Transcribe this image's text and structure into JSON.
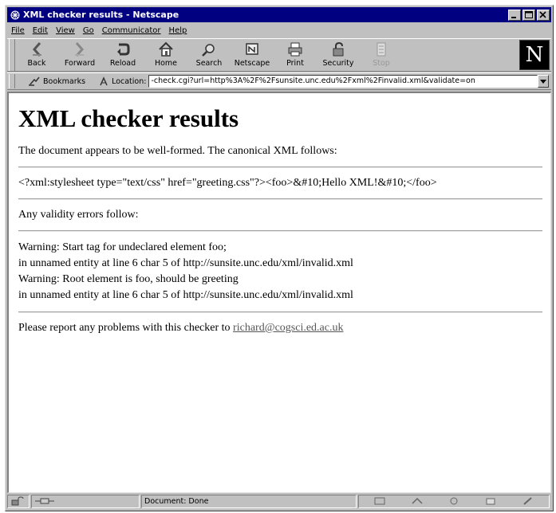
{
  "window": {
    "title": "XML checker results - Netscape"
  },
  "menu": [
    "File",
    "Edit",
    "View",
    "Go",
    "Communicator",
    "Help"
  ],
  "toolbar": [
    {
      "label": "Back",
      "icon": "back-arrow-icon",
      "enabled": true
    },
    {
      "label": "Forward",
      "icon": "forward-arrow-icon",
      "enabled": true
    },
    {
      "label": "Reload",
      "icon": "reload-icon",
      "enabled": true
    },
    {
      "label": "Home",
      "icon": "home-icon",
      "enabled": true
    },
    {
      "label": "Search",
      "icon": "search-icon",
      "enabled": true
    },
    {
      "label": "Netscape",
      "icon": "netscape-icon",
      "enabled": true
    },
    {
      "label": "Print",
      "icon": "printer-icon",
      "enabled": true
    },
    {
      "label": "Security",
      "icon": "lock-icon",
      "enabled": true
    },
    {
      "label": "Stop",
      "icon": "stop-icon",
      "enabled": false
    }
  ],
  "logo": "N",
  "locbar": {
    "bookmarks_label": "Bookmarks",
    "location_label": "Location:",
    "url": "-check.cgi?url=http%3A%2F%2Fsunsite.unc.edu%2Fxml%2Finvalid.xml&validate=on"
  },
  "page": {
    "heading": "XML checker results",
    "well_formed": "The document appears to be well-formed. The canonical XML follows:",
    "canonical_xml": "<?xml:stylesheet type=\"text/css\" href=\"greeting.css\"?><foo>&#10;Hello XML!&#10;</foo>",
    "validity_intro": "Any validity errors follow:",
    "warnings": [
      "Warning: Start tag for undeclared element foo;",
      "in unnamed entity at line 6 char 5 of http://sunsite.unc.edu/xml/invalid.xml",
      "Warning: Root element is foo, should be greeting",
      "in unnamed entity at line 6 char 5 of http://sunsite.unc.edu/xml/invalid.xml"
    ],
    "report_text": "Please report any problems with this checker to ",
    "report_email": "richard@cogsci.ed.ac.uk"
  },
  "status": {
    "text": "Document: Done"
  },
  "colors": {
    "titlebar": "#000080",
    "chrome": "#c0c0c0",
    "content_bg": "#ffffff"
  }
}
